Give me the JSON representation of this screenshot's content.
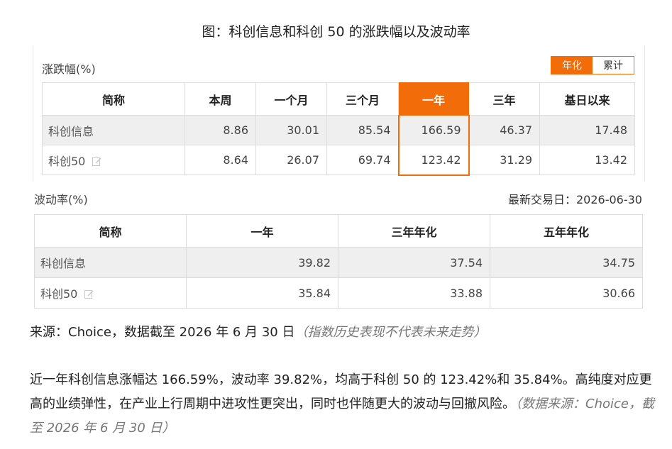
{
  "figure_title": "图：科创信息和科创 50 的涨跌幅以及波动率",
  "returns": {
    "label": "涨跌幅(%)",
    "toggle": {
      "annualized": "年化",
      "cumulative": "累计",
      "active": "annualized"
    },
    "headers": [
      "简称",
      "本周",
      "一个月",
      "三个月",
      "一年",
      "三年",
      "基日以来"
    ],
    "highlight_column": "一年",
    "rows": [
      {
        "name": "科创信息",
        "values": [
          "8.86",
          "30.01",
          "85.54",
          "166.59",
          "46.37",
          "17.48"
        ]
      },
      {
        "name": "科创50",
        "editable": true,
        "values": [
          "8.64",
          "26.07",
          "69.74",
          "123.42",
          "31.29",
          "13.42"
        ]
      }
    ]
  },
  "volatility": {
    "label": "波动率(%)",
    "latest_trade_date_label": "最新交易日：2026-06-30",
    "headers": [
      "简称",
      "一年",
      "三年年化",
      "五年年化"
    ],
    "rows": [
      {
        "name": "科创信息",
        "values": [
          "39.82",
          "37.54",
          "34.75"
        ]
      },
      {
        "name": "科创50",
        "editable": true,
        "values": [
          "35.84",
          "33.88",
          "30.66"
        ]
      }
    ]
  },
  "source_note": {
    "text": "来源：Choice，数据截至 2026 年 6 月 30 日",
    "disclaimer": "（指数历史表现不代表未来走势）"
  },
  "paragraph": {
    "text": "近一年科创信息涨幅达 166.59%，波动率 39.82%，均高于科创 50 的 123.42%和 35.84%。高纯度对应更高的业绩弹性，在产业上行周期中进攻性更突出，同时也伴随更大的波动与回撤风险。",
    "source": "（数据来源：Choice，截至 2026 年 6 月 30 日）"
  },
  "colors": {
    "accent": "#f36c0a",
    "row_alt": "#efefef",
    "border": "#dcdcdc"
  },
  "icons": {
    "edit": "edit-icon"
  }
}
